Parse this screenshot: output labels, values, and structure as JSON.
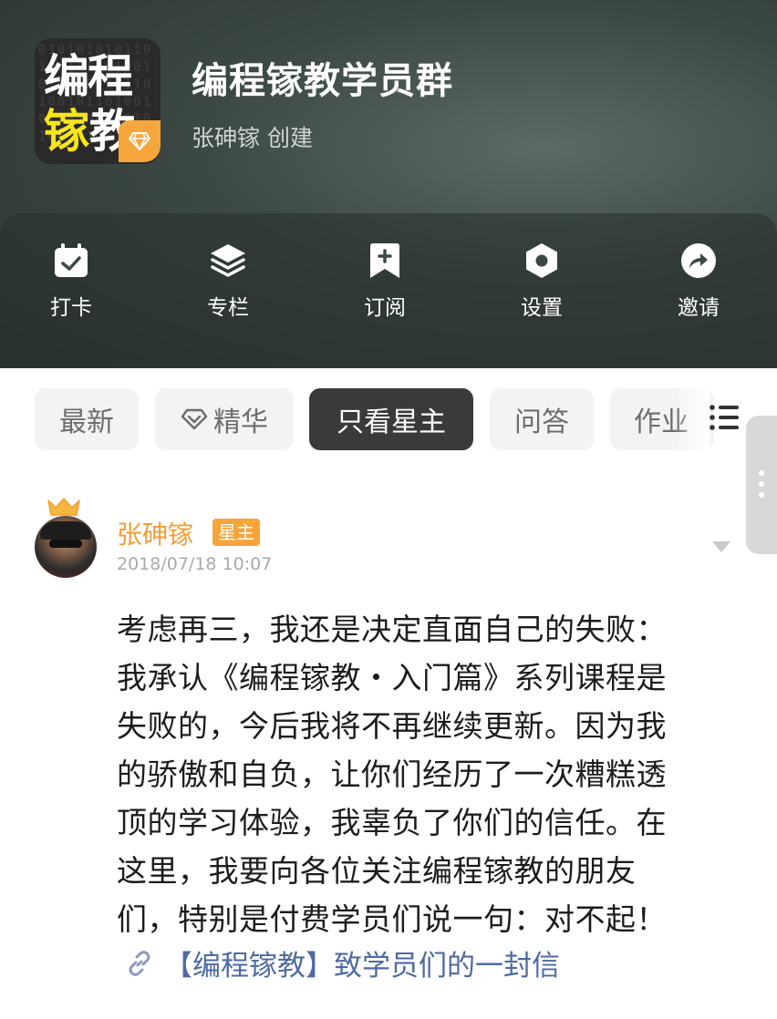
{
  "group": {
    "logo_bits": "010101010110100101101001011010010110100101101001011010010110100101101001",
    "logo_line1": "编程",
    "logo_line2_yellow": "镓",
    "logo_line2_white": "教",
    "title": "编程镓教学员群",
    "creator": "张砷镓 创建"
  },
  "actions": [
    {
      "label": "打卡",
      "icon": "calendar-check-icon"
    },
    {
      "label": "专栏",
      "icon": "layers-icon"
    },
    {
      "label": "订阅",
      "icon": "bookmark-plus-icon"
    },
    {
      "label": "设置",
      "icon": "hexagon-settings-icon"
    },
    {
      "label": "邀请",
      "icon": "share-arrow-icon"
    }
  ],
  "tabs": [
    {
      "label": "最新"
    },
    {
      "label": "精华",
      "icon": "diamond-icon"
    },
    {
      "label": "只看星主",
      "active": true
    },
    {
      "label": "问答"
    },
    {
      "label": "作业"
    }
  ],
  "post": {
    "author": "张砷镓",
    "badge": "星主",
    "time": "2018/07/18 10:07",
    "lines": [
      "考虑再三，我还是决定直面自己的失败：",
      "我承认《编程镓教・入门篇》系列课程是",
      "失败的，今后我将不再继续更新。因为我",
      "的骄傲和自负，让你们经历了一次糟糕透",
      "顶的学习体验，我辜负了你们的信任。在",
      "这里，我要向各位关注编程镓教的朋友",
      "们，特别是付费学员们说一句：对不起！"
    ],
    "link_text": "【编程镓教】致学员们的一封信"
  },
  "colors": {
    "accent_orange": "#f39d34",
    "badge_orange": "#f6a43a",
    "active_tab": "#3a3a3a",
    "link_blue": "#4d6aa3"
  }
}
